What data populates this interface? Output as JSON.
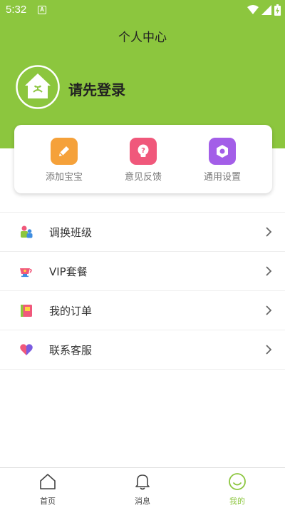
{
  "status_bar": {
    "time": "5:32",
    "notification_icon_letter": "A"
  },
  "header": {
    "title": "个人中心",
    "login_prompt": "请先登录"
  },
  "quick_actions": [
    {
      "label": "添加宝宝",
      "icon": "pencil-icon",
      "color": "#f5a13a"
    },
    {
      "label": "意见反馈",
      "icon": "lightbulb-icon",
      "color": "#f0587b"
    },
    {
      "label": "通用设置",
      "icon": "gear-icon",
      "color": "#a35ee8"
    }
  ],
  "menu": [
    {
      "label": "调换班级",
      "icon": "class-switch-icon"
    },
    {
      "label": "VIP套餐",
      "icon": "vip-cup-icon"
    },
    {
      "label": "我的订单",
      "icon": "order-book-icon"
    },
    {
      "label": "联系客服",
      "icon": "heart-service-icon"
    }
  ],
  "tabs": [
    {
      "label": "首页",
      "icon": "home-icon",
      "active": false
    },
    {
      "label": "消息",
      "icon": "bell-icon",
      "active": false
    },
    {
      "label": "我的",
      "icon": "smile-icon",
      "active": true
    }
  ],
  "colors": {
    "brand_green": "#8cc63e"
  }
}
